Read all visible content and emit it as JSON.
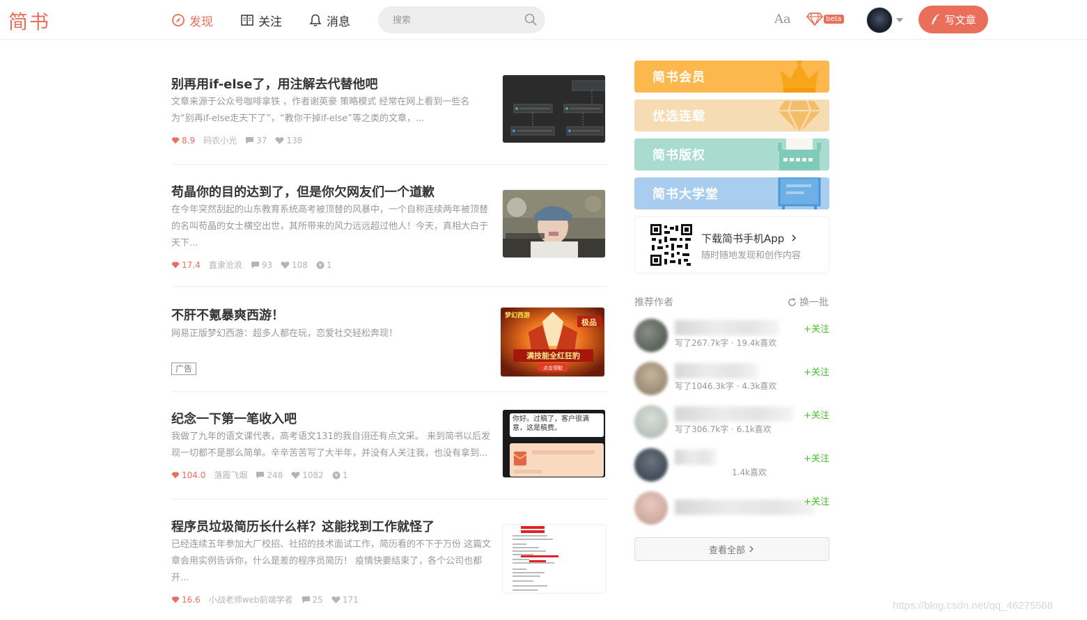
{
  "header": {
    "logo": "简书",
    "nav": [
      {
        "label": "发现",
        "active": true,
        "icon": "compass-icon"
      },
      {
        "label": "关注",
        "active": false,
        "icon": "book-icon"
      },
      {
        "label": "消息",
        "active": false,
        "icon": "bell-icon"
      }
    ],
    "search": {
      "placeholder": "搜索"
    },
    "font_setting": "Aa",
    "beta_badge": "beta",
    "write_button": "写文章",
    "accent_color": "#ea6f5a"
  },
  "articles": [
    {
      "title": "别再用if-else了，用注解去代替他吧",
      "abstract": "文章来源于公众号咖啡拿铁 ，作者谢英豪 策略模式 经常在网上看到一些名为“别再if-else走天下了”，“教你干掉if-else”等之类的文章，...",
      "score": "8.9",
      "author": "码农小光",
      "comments": "37",
      "likes": "138",
      "rewards": null
    },
    {
      "title": "苟晶你的目的达到了，但是你欠网友们一个道歉",
      "abstract": "在今年突然刮起的山东教育系统高考被顶替的风暴中，一个自称连续两年被顶替的名叫苟晶的女士横空出世，其所带来的风力远远超过他人！今天，真相大白于天下...",
      "score": "17.4",
      "author": "直隶沧浪",
      "comments": "93",
      "likes": "108",
      "rewards": "1"
    },
    {
      "title": "不肝不氪暴爽西游！",
      "abstract": "网易正版梦幻西游：超多人都在玩，恋爱社交轻松奔现！",
      "ad_tag": "广告",
      "thumb_text": "满技能全红狂豹",
      "thumb_button": "点击领取",
      "thumb_badge": "极品"
    },
    {
      "title": "纪念一下第一笔收入吧",
      "abstract": "我做了九年的语文课代表，高考语文131的我自诩还有点文采。 来到简书以后发现一切都不是那么简单。辛辛苦苦写了大半年，并没有人关注我，也没有拿到...",
      "score": "104.0",
      "author": "落霞飞烟",
      "comments": "248",
      "likes": "1082",
      "rewards": "1",
      "thumb_text": "你好。过稿了，客户很满意，这是稿费。"
    },
    {
      "title": "程序员垃圾简历长什么样？这能找到工作就怪了",
      "abstract": "已经连续五年参加大厂校招、社招的技术面试工作，简历看的不下于万份 这篇文章会用实例告诉你，什么是差的程序员简历！ 疫情快要结束了，各个公司也都开...",
      "score": "16.6",
      "author": "小战老师web前端学者",
      "comments": "25",
      "likes": "171",
      "rewards": null
    }
  ],
  "sidebar": {
    "banners": [
      {
        "label": "简书会员",
        "color": "#fdb84d",
        "icon": "crown-icon"
      },
      {
        "label": "优选连载",
        "color": "#f5dcb2",
        "icon": "diamond-icon"
      },
      {
        "label": "简书版权",
        "color": "#a9dccf",
        "icon": "typewriter-icon"
      },
      {
        "label": "简书大学堂",
        "color": "#a9cdee",
        "icon": "blackboard-icon"
      }
    ],
    "download": {
      "title": "下载简书手机App",
      "subtitle": "随时随地发现和创作内容"
    },
    "recommend_title": "推荐作者",
    "switch_label": "换一批",
    "authors": [
      {
        "stats": "写了267.7k字 · 19.4k喜欢",
        "follow": "+关注"
      },
      {
        "stats": "写了1046.3k字 · 4.3k喜欢",
        "follow": "+关注"
      },
      {
        "stats": "写了306.7k字 · 6.1k喜欢",
        "follow": "+关注"
      },
      {
        "stats": "1.4k喜欢",
        "follow": "+关注"
      },
      {
        "stats": "",
        "follow": "+关注"
      }
    ],
    "see_all": "查看全部"
  },
  "watermark": "https://blog.csdn.net/qq_46275568"
}
